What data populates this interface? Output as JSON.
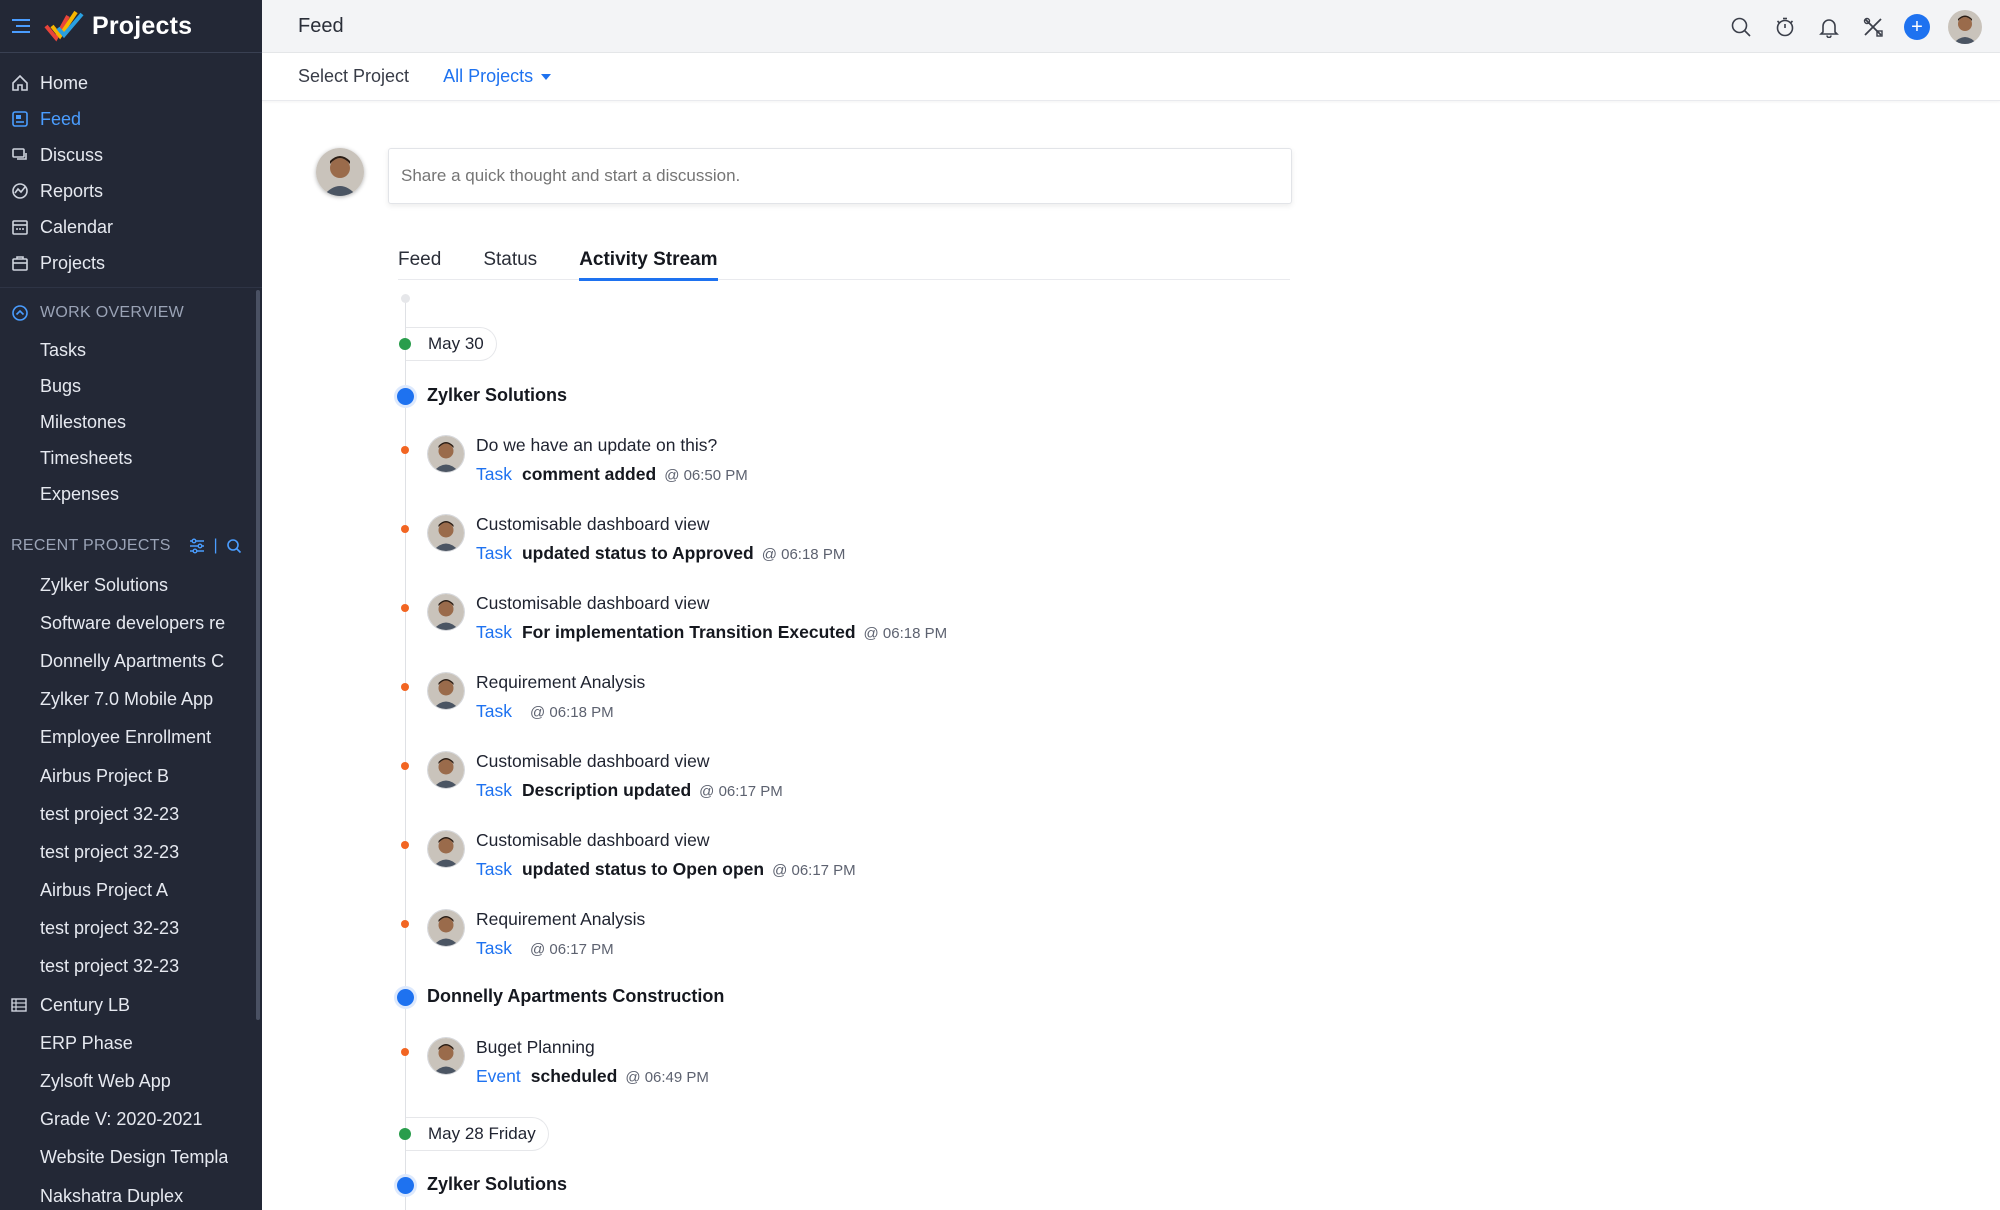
{
  "app": {
    "name": "Projects"
  },
  "sidebar": {
    "nav": [
      {
        "label": "Home",
        "icon": "home-icon"
      },
      {
        "label": "Feed",
        "icon": "feed-icon",
        "active": true
      },
      {
        "label": "Discuss",
        "icon": "discuss-icon"
      },
      {
        "label": "Reports",
        "icon": "reports-icon"
      },
      {
        "label": "Calendar",
        "icon": "calendar-icon"
      },
      {
        "label": "Projects",
        "icon": "projects-icon"
      }
    ],
    "work_overview": {
      "heading": "WORK OVERVIEW",
      "items": [
        "Tasks",
        "Bugs",
        "Milestones",
        "Timesheets",
        "Expenses"
      ]
    },
    "recent_projects": {
      "heading": "RECENT PROJECTS",
      "items": [
        "Zylker Solutions",
        "Software developers re",
        "Donnelly Apartments C",
        "Zylker 7.0 Mobile App",
        "Employee Enrollment",
        "Airbus Project B",
        "test project 32-23",
        "test project 32-23",
        "Airbus Project A",
        "test project 32-23",
        "test project 32-23",
        "Century LB",
        "ERP Phase",
        "Zylsoft Web App",
        "Grade V: 2020-2021",
        "Website Design Templa",
        "Nakshatra Duplex"
      ]
    }
  },
  "topbar": {
    "title": "Feed"
  },
  "subheader": {
    "label": "Select Project",
    "selected": "All Projects"
  },
  "composer": {
    "placeholder": "Share a quick thought and start a discussion."
  },
  "tabs": [
    {
      "label": "Feed"
    },
    {
      "label": "Status"
    },
    {
      "label": "Activity Stream",
      "active": true
    }
  ],
  "timeline": {
    "dates": [
      "May 30",
      "May 28 Friday"
    ],
    "projects": [
      "Zylker Solutions",
      "Donnelly Apartments Construction",
      "Zylker Solutions"
    ],
    "activities": [
      {
        "title": "Do we have an update on this?",
        "type": "Task",
        "action": "comment added",
        "time": "@ 06:50 PM"
      },
      {
        "title": "Customisable dashboard view",
        "type": "Task",
        "action": "updated status to Approved",
        "time": "@ 06:18 PM"
      },
      {
        "title": "Customisable dashboard view",
        "type": "Task",
        "action": "For implementation Transition Executed",
        "time": "@ 06:18 PM"
      },
      {
        "title": "Requirement Analysis",
        "type": "Task",
        "action": "",
        "time": "@ 06:18 PM"
      },
      {
        "title": "Customisable dashboard view",
        "type": "Task",
        "action": "Description updated",
        "time": "@ 06:17 PM"
      },
      {
        "title": "Customisable dashboard view",
        "type": "Task",
        "action": "updated status to Open open",
        "time": "@ 06:17 PM"
      },
      {
        "title": "Requirement Analysis",
        "type": "Task",
        "action": "",
        "time": "@ 06:17 PM"
      },
      {
        "title": "Buget Planning",
        "type": "Event",
        "action": "scheduled",
        "time": "@ 06:49 PM"
      }
    ]
  },
  "colors": {
    "sidebar_bg": "#232836",
    "accent": "#1e72f0",
    "date_dot": "#2a9d4c",
    "activity_dot": "#f26522"
  }
}
